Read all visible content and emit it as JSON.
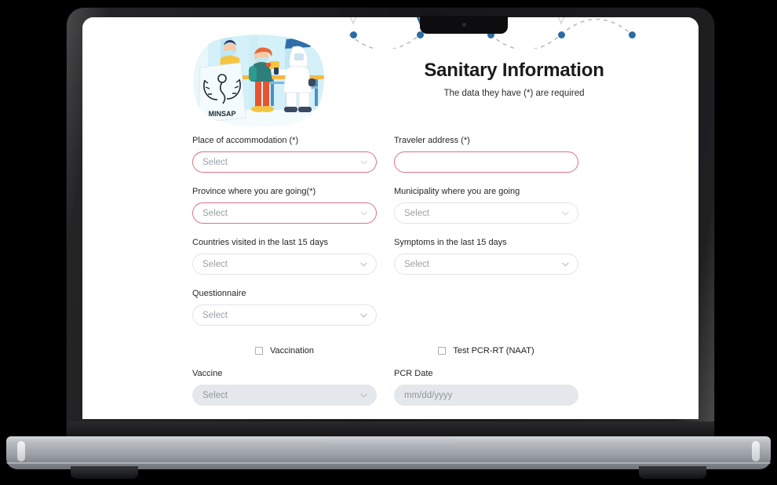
{
  "header": {
    "title": "Sanitary Information",
    "subtitle": "The data they have (*) are required",
    "logo_text": "MINSAP",
    "illustration_name": "airport-health-screening-illustration"
  },
  "stepper": {
    "steps": 5,
    "active_color": "#2b6ca3",
    "line_color": "#b9bcc0"
  },
  "form": {
    "fields": [
      {
        "label": "Place of accommodation (*)",
        "value": "Select",
        "type": "select",
        "required": true,
        "disabled": false
      },
      {
        "label": "Traveler address (*)",
        "value": "",
        "type": "text",
        "required": true,
        "disabled": false
      },
      {
        "label": "Province where you are going(*)",
        "value": "Select",
        "type": "select",
        "required": true,
        "disabled": false
      },
      {
        "label": "Municipality where you are going",
        "value": "Select",
        "type": "select",
        "required": false,
        "disabled": false
      },
      {
        "label": "Countries visited in the last 15 days",
        "value": "Select",
        "type": "select",
        "required": false,
        "disabled": false
      },
      {
        "label": "Symptoms in the last 15 days",
        "value": "Select",
        "type": "select",
        "required": false,
        "disabled": false
      },
      {
        "label": "Questionnaire",
        "value": "Select",
        "type": "select",
        "required": false,
        "disabled": false
      },
      {
        "label": "Vaccine",
        "value": "Select",
        "type": "select",
        "required": false,
        "disabled": true
      },
      {
        "label": "PCR Date",
        "value": "mm/dd/yyyy",
        "type": "date",
        "required": false,
        "disabled": true
      }
    ],
    "checkboxes": [
      {
        "label": "Vaccination",
        "checked": false
      },
      {
        "label": "Test PCR-RT (NAAT)",
        "checked": false
      }
    ]
  },
  "colors": {
    "required_border": "#dd7184",
    "normal_border": "#e2e4e7",
    "disabled_bg": "#e4e8ec",
    "placeholder": "#9aa0a6",
    "accent_blue": "#2b6ca3"
  }
}
